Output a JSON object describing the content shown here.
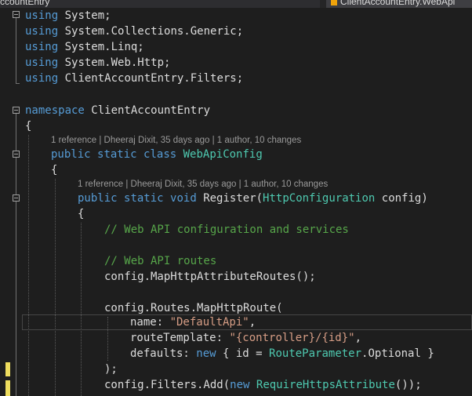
{
  "tabs": {
    "left_label": "ccountEntry",
    "right_label": "ClientAccountEntry.WebApi"
  },
  "code": {
    "l1": {
      "kw": "using",
      "rest": " System;"
    },
    "l2": {
      "kw": "using",
      "rest": " System.Collections.Generic;"
    },
    "l3": {
      "kw": "using",
      "rest": " System.Linq;"
    },
    "l4": {
      "kw": "using",
      "rest": " System.Web.Http;"
    },
    "l5": {
      "kw": "using",
      "rest": " ClientAccountEntry.Filters;"
    },
    "l6": {
      "kw": "namespace",
      "rest": " ClientAccountEntry"
    },
    "l7": {
      "text": "{"
    },
    "lens1": "1 reference | Dheeraj Dixit, 35 days ago | 1 author, 10 changes",
    "l8": {
      "kw1": "public",
      "kw2": "static",
      "kw3": "class",
      "type": "WebApiConfig"
    },
    "l9": {
      "text": "{"
    },
    "lens2": "1 reference | Dheeraj Dixit, 35 days ago | 1 author, 10 changes",
    "l10": {
      "kw1": "public",
      "kw2": "static",
      "kw3": "void",
      "name": "Register(",
      "type": "HttpConfiguration",
      "rest": " config)"
    },
    "l11": {
      "text": "{"
    },
    "l12": {
      "comment": "// Web API configuration and services"
    },
    "l13": {
      "comment": "// Web API routes"
    },
    "l14": {
      "text": "config.MapHttpAttributeRoutes();"
    },
    "l15": {
      "text": "config.Routes.MapHttpRoute("
    },
    "l16": {
      "pre": "name: ",
      "str": "\"DefaultApi\"",
      "post": ","
    },
    "l17": {
      "pre": "routeTemplate: ",
      "str": "\"{controller}/{id}\"",
      "post": ","
    },
    "l18": {
      "pre": "defaults: ",
      "kw": "new",
      "mid": " { id = ",
      "type": "RouteParameter",
      "post": ".Optional }"
    },
    "l19": {
      "text": ");"
    },
    "l20": {
      "pre": "config.Filters.Add(",
      "kw": "new",
      "sp": " ",
      "type": "RequireHttpsAttribute",
      "post": "());"
    }
  },
  "colors": {
    "background": "#1e1e1e",
    "keyword": "#569cd6",
    "type": "#4ec9b0",
    "string": "#d69d85",
    "comment": "#57a64a",
    "text": "#dcdcdc",
    "change_marker": "#eedd5e"
  }
}
